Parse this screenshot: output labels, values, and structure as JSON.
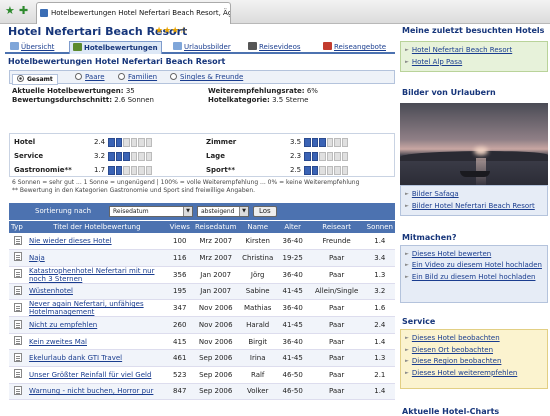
{
  "browser": {
    "tab_title": "Hotelbewertungen Hotel Nefertari Beach Resort, Ägy..."
  },
  "hotel": {
    "name": "Hotel Nefertari Beach Resort",
    "stars": "★★★☆"
  },
  "tabs": [
    {
      "label": "Übersicht",
      "active": false
    },
    {
      "label": "Hotelbewertungen",
      "active": true
    },
    {
      "label": "Urlaubsbilder",
      "active": false
    },
    {
      "label": "Reisevideos",
      "active": false
    },
    {
      "label": "Reiseangebote",
      "active": false
    }
  ],
  "section_title": "Hotelbewertungen Hotel Nefertari Beach Resort",
  "subtabs": [
    {
      "label": "Gesamt",
      "selected": true
    },
    {
      "label": "Paare",
      "selected": false
    },
    {
      "label": "Familien",
      "selected": false
    },
    {
      "label": "Singles & Freunde",
      "selected": false
    }
  ],
  "summary": {
    "count_label": "Aktuelle Hotelbewertungen:",
    "count_value": "35",
    "avg_label": "Bewertungsdurchschnitt:",
    "avg_value": "2.6 Sonnen",
    "rec_label": "Weiterempfehlungsrate:",
    "rec_value": "6%",
    "cat_label": "Hotelkategorie:",
    "cat_value": "3.5 Sterne"
  },
  "categories": [
    {
      "label": "Hotel",
      "value": "2.4",
      "filled": 2
    },
    {
      "label": "Zimmer",
      "value": "3.5",
      "filled": 3
    },
    {
      "label": "Service",
      "value": "3.2",
      "filled": 3
    },
    {
      "label": "Lage",
      "value": "2.3",
      "filled": 2
    },
    {
      "label": "Gastronomie**",
      "value": "1.7",
      "filled": 2
    },
    {
      "label": "Sport**",
      "value": "2.5",
      "filled": 2
    }
  ],
  "legend": {
    "line1": "6 Sonnen = sehr gut ... 1 Sonne = ungenügend | 100% = volle Weiterempfehlung ... 0% = keine Weiterempfehlung",
    "line2": "** Bewertung in den Kategorien Gastronomie und Sport sind freiwillige Angaben."
  },
  "sort": {
    "label": "Sortierung nach",
    "field": "Reisedatum",
    "order": "absteigend",
    "button": "Los"
  },
  "table": {
    "headers": [
      "Typ",
      "Titel der Hotelbewertung",
      "Views",
      "Reisedatum",
      "Name",
      "Alter",
      "Reiseart",
      "Sonnen"
    ],
    "rows": [
      {
        "title": "Nie wieder dieses Hotel",
        "views": "100",
        "date": "Mrz 2007",
        "name": "Kirsten",
        "age": "36-40",
        "type": "Freunde",
        "suns": "1.4"
      },
      {
        "title": "Naja",
        "views": "116",
        "date": "Mrz 2007",
        "name": "Christina",
        "age": "19-25",
        "type": "Paar",
        "suns": "3.4"
      },
      {
        "title": "Katastrophenhotel Nefertari mit nur noch 3 Sternen",
        "views": "356",
        "date": "Jan 2007",
        "name": "Jörg",
        "age": "36-40",
        "type": "Paar",
        "suns": "1.3"
      },
      {
        "title": "Wüstenhotel",
        "views": "195",
        "date": "Jan 2007",
        "name": "Sabine",
        "age": "41-45",
        "type": "Allein/Single",
        "suns": "3.2"
      },
      {
        "title": "Never again Nefertari, unfähiges Hotelmanagement",
        "views": "347",
        "date": "Nov 2006",
        "name": "Mathias",
        "age": "36-40",
        "type": "Paar",
        "suns": "1.6"
      },
      {
        "title": "Nicht zu empfehlen",
        "views": "260",
        "date": "Nov 2006",
        "name": "Harald",
        "age": "41-45",
        "type": "Paar",
        "suns": "2.4"
      },
      {
        "title": "Kein zweites Mal",
        "views": "415",
        "date": "Nov 2006",
        "name": "Birgit",
        "age": "36-40",
        "type": "Paar",
        "suns": "1.4"
      },
      {
        "title": "Ekelurlaub dank GTI Travel",
        "views": "461",
        "date": "Sep 2006",
        "name": "Irina",
        "age": "41-45",
        "type": "Paar",
        "suns": "1.3"
      },
      {
        "title": "Unser Größter Reinfall für viel Geld",
        "views": "523",
        "date": "Sep 2006",
        "name": "Ralf",
        "age": "46-50",
        "type": "Paar",
        "suns": "2.1"
      },
      {
        "title": "Warnung - nicht buchen, Horror pur",
        "views": "847",
        "date": "Sep 2006",
        "name": "Volker",
        "age": "46-50",
        "type": "Paar",
        "suns": "1.4"
      }
    ]
  },
  "sidebar": {
    "recent_title": "Meine zuletzt besuchten Hotels",
    "recent": [
      "Hotel Nefertari Beach Resort",
      "Hotel Alp Pasa"
    ],
    "photos_title": "Bilder von Urlaubern",
    "photo_links": [
      "Bilder Safaga",
      "Bilder Hotel Nefertari Beach Resort"
    ],
    "join_title": "Mitmachen?",
    "join_links": [
      "Dieses Hotel bewerten",
      "Ein Video zu diesem Hotel hochladen",
      "Ein Bild zu diesem Hotel hochladen"
    ],
    "service_title": "Service",
    "service_links": [
      "Dieses Hotel beobachten",
      "Diesen Ort beobachten",
      "Diese Region beobachten",
      "Dieses Hotel weiterempfehlen"
    ],
    "charts_title": "Aktuelle Hotel-Charts"
  }
}
